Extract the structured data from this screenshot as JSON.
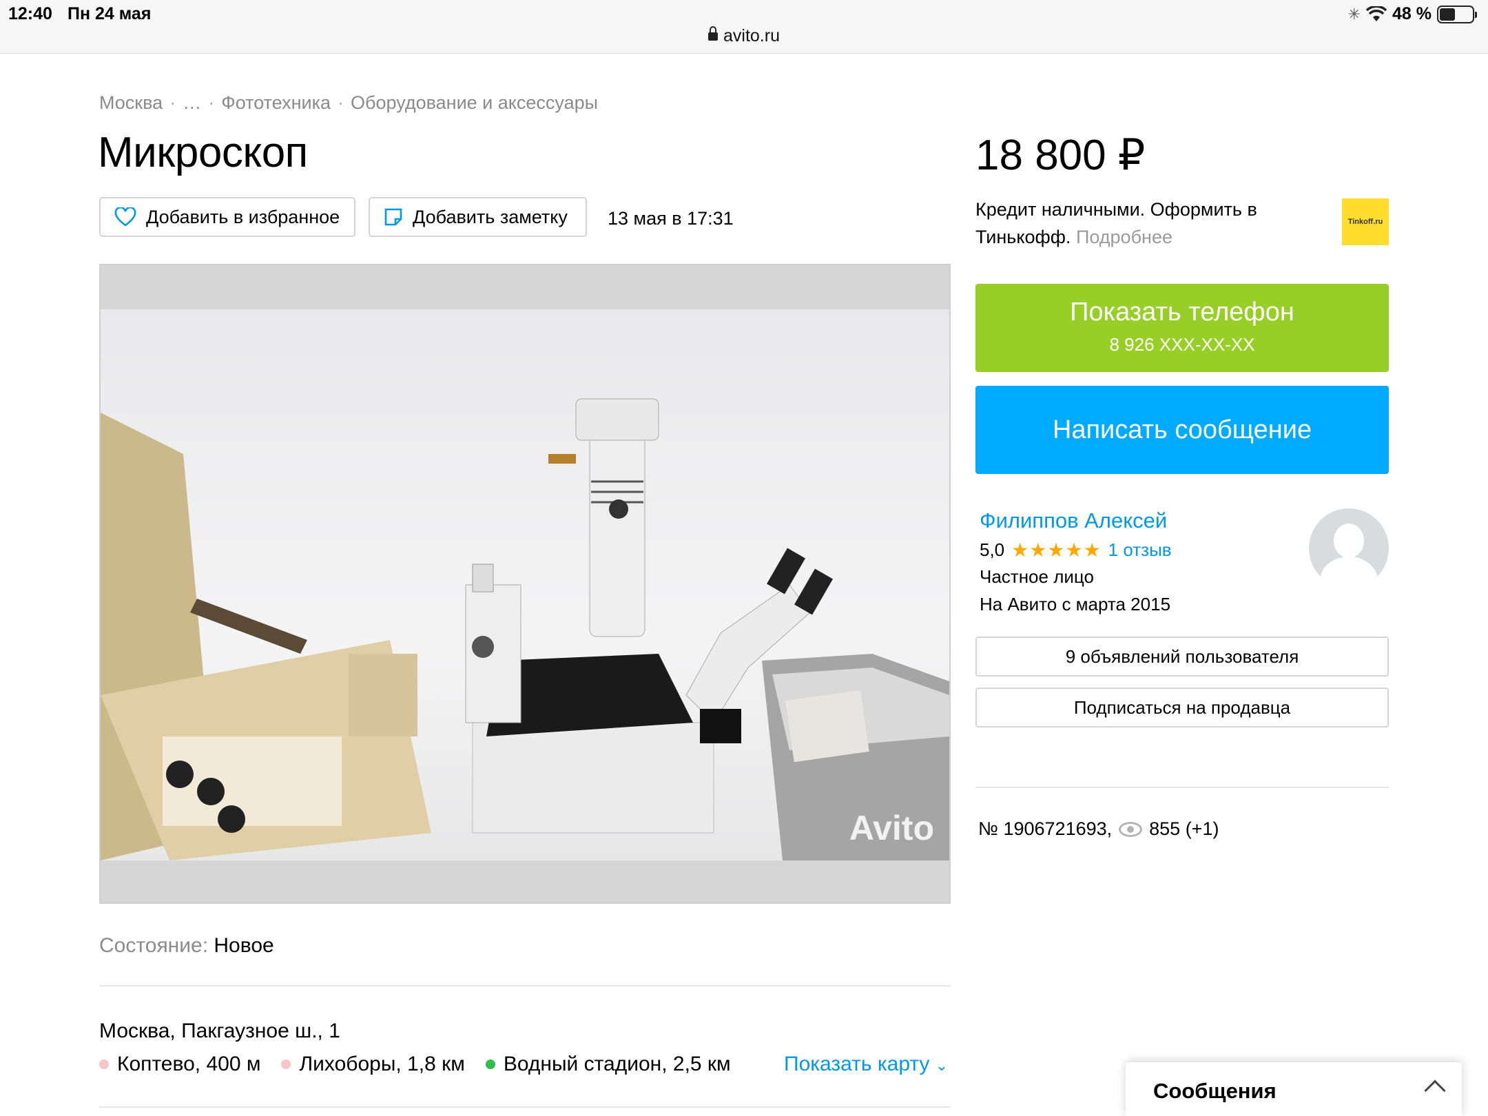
{
  "status_bar": {
    "time": "12:40",
    "date": "Пн 24 мая",
    "battery": "48 %",
    "battery_level": 0.48,
    "url": "avito.ru"
  },
  "breadcrumb": [
    "Москва",
    "…",
    "Фототехника",
    "Оборудование и аксессуары"
  ],
  "breadcrumb_sep": "·",
  "listing": {
    "title": "Микроскоп",
    "favorite_label": "Добавить в избранное",
    "note_label": "Добавить заметку",
    "posted": "13 мая в 17:31",
    "photo_watermark": "Avito",
    "condition_label": "Состояние:",
    "condition_value": "Новое",
    "address": "Москва, Пакгаузное ш., 1",
    "metro": [
      {
        "name": "Коптево, 400 м",
        "color": "#f5c6c6"
      },
      {
        "name": "Лихоборы, 1,8 км",
        "color": "#f5c6c6"
      },
      {
        "name": "Водный стадион, 2,5 км",
        "color": "#2dbe4b"
      }
    ],
    "show_map": "Показать карту"
  },
  "sidebar": {
    "price": "18 800 ₽",
    "credit_text": "Кредит наличными. Оформить в Тинькофф.",
    "credit_more": "Подробнее",
    "tinkoff_logo": "Tinkoff.ru",
    "phone_button": "Показать телефон",
    "phone_masked": "8 926 XXX-XX-XX",
    "message_button": "Написать сообщение",
    "seller": {
      "name": "Филиппов Алексей",
      "rating": "5,0",
      "stars": "★★★★★",
      "reviews": "1 отзыв",
      "type": "Частное лицо",
      "since": "На Авито с марта 2015"
    },
    "ads_button": "9 объявлений пользователя",
    "subscribe_button": "Подписаться на продавца",
    "item_number": "№ 1906721693,",
    "views": "855 (+1)"
  },
  "messages_panel": {
    "label": "Сообщения"
  },
  "colors": {
    "green": "#97cf26",
    "blue": "#00aaff",
    "link": "#0099e6",
    "star": "#ffa800"
  }
}
